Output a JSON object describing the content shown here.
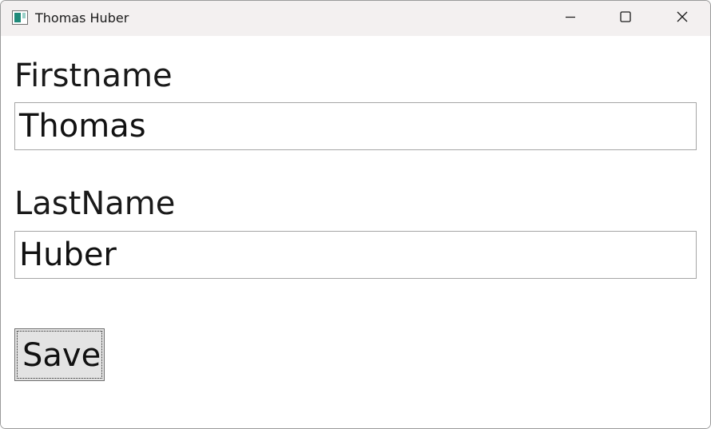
{
  "window": {
    "title": "Thomas Huber",
    "controls": {
      "minimize_icon": "minimize-icon",
      "maximize_icon": "maximize-icon",
      "close_icon": "close-icon"
    }
  },
  "form": {
    "firstname_label": "Firstname",
    "firstname_value": "Thomas",
    "lastname_label": "LastName",
    "lastname_value": "Huber",
    "save_label": "Save"
  },
  "colors": {
    "titlebar_bg": "#f3f0f0",
    "button_bg": "#e3e3e3",
    "textbox_border": "#a5a5a5",
    "app_icon_accent": "#1f8a7a"
  }
}
